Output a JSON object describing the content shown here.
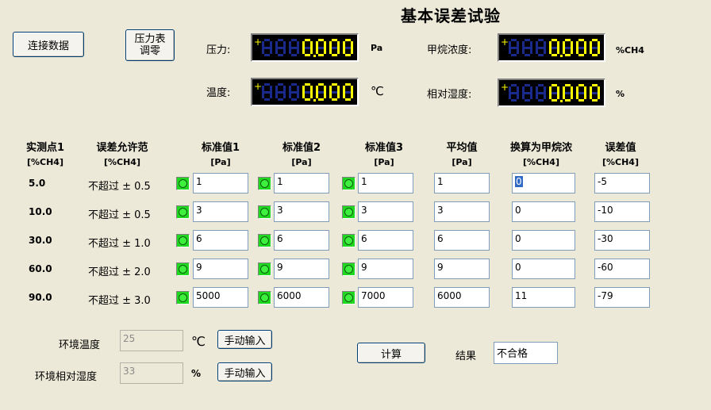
{
  "title": "基本误差试验",
  "buttons": {
    "connect": "连接数据",
    "zero_line1": "压力表",
    "zero_line2": "调零",
    "calculate": "计算",
    "manual_temp": "手动输入",
    "manual_humidity": "手动输入"
  },
  "readouts": {
    "pressure": {
      "label": "压力:",
      "value": "0.000",
      "unit": "Pa"
    },
    "methane": {
      "label": "甲烷浓度:",
      "value": "0.000",
      "unit": "%CH4"
    },
    "temperature": {
      "label": "温度:",
      "value": "0.000",
      "unit": "℃"
    },
    "humidity": {
      "label": "相对湿度:",
      "value": "0.000",
      "unit": "%"
    }
  },
  "table": {
    "headers": [
      {
        "name": "实测点1",
        "unit": "[%CH4]"
      },
      {
        "name": "误差允许范",
        "unit": "[%CH4]"
      },
      {
        "name": "标准值1",
        "unit": "[Pa]"
      },
      {
        "name": "标准值2",
        "unit": "[Pa]"
      },
      {
        "name": "标准值3",
        "unit": "[Pa]"
      },
      {
        "name": "平均值",
        "unit": "[Pa]"
      },
      {
        "name": "换算为甲烷浓",
        "unit": "[%CH4]"
      },
      {
        "name": "误差值",
        "unit": "[%CH4]"
      }
    ],
    "rows": [
      {
        "point": "5.0",
        "tolerance": "不超过 ± 0.5",
        "std1": "1",
        "std2": "1",
        "std3": "1",
        "avg": "1",
        "methane": "0",
        "error": "-5"
      },
      {
        "point": "10.0",
        "tolerance": "不超过 ± 0.5",
        "std1": "3",
        "std2": "3",
        "std3": "3",
        "avg": "3",
        "methane": "0",
        "error": "-10"
      },
      {
        "point": "30.0",
        "tolerance": "不超过 ± 1.0",
        "std1": "6",
        "std2": "6",
        "std3": "6",
        "avg": "6",
        "methane": "0",
        "error": "-30"
      },
      {
        "point": "60.0",
        "tolerance": "不超过 ± 2.0",
        "std1": "9",
        "std2": "9",
        "std3": "9",
        "avg": "9",
        "methane": "0",
        "error": "-60"
      },
      {
        "point": "90.0",
        "tolerance": "不超过 ± 3.0",
        "std1": "5000",
        "std2": "6000",
        "std3": "7000",
        "avg": "6000",
        "methane": "11",
        "error": "-79"
      }
    ]
  },
  "environment": {
    "temp_label": "环境温度",
    "temp_value": "25",
    "temp_unit": "℃",
    "humidity_label": "环境相对湿度",
    "humidity_value": "33",
    "humidity_unit": "%"
  },
  "result": {
    "label": "结果",
    "value": "不合格"
  },
  "colors": {
    "background": "#ece9d8",
    "led_green": "#1fd81f",
    "lcd_digit": "#ffff00",
    "lcd_dim": "#1a2a8a"
  }
}
